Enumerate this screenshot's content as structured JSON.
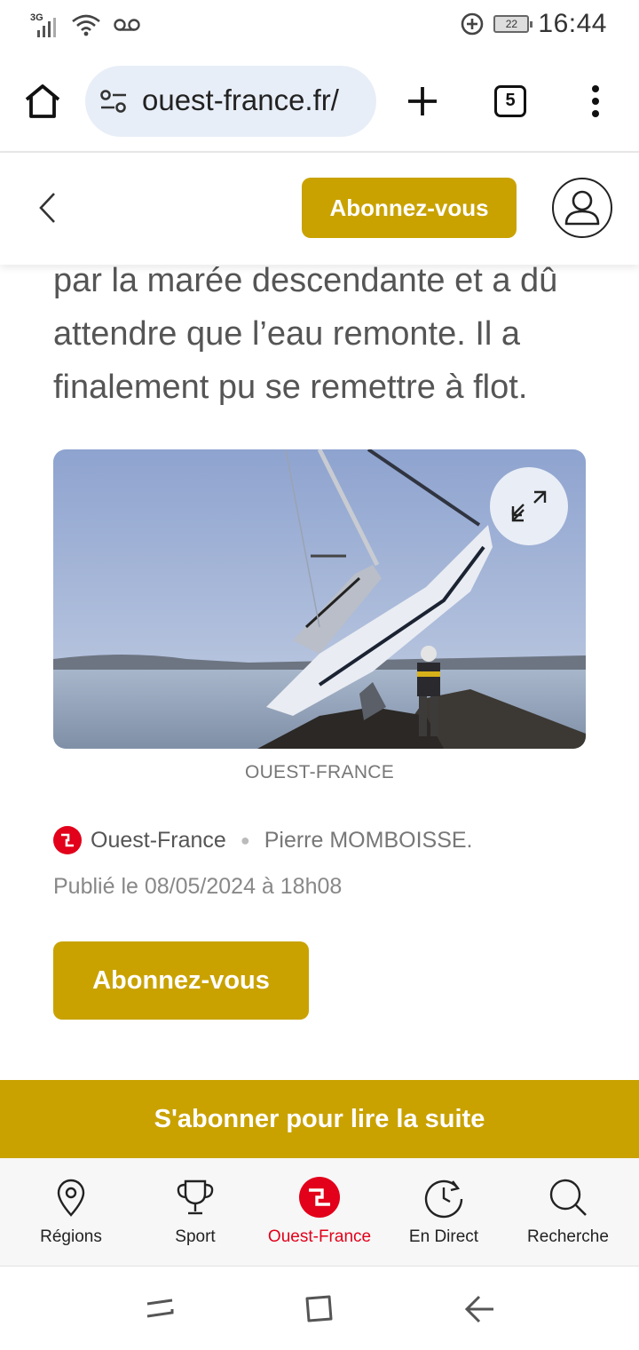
{
  "status_bar": {
    "network": "3G",
    "battery": "22",
    "time": "16:44"
  },
  "browser": {
    "url": "ouest-france.fr/",
    "tab_count": "5"
  },
  "site_header": {
    "subscribe_label": "Abonnez-vous"
  },
  "article": {
    "text": "par la marée descendante et a dû attendre que l’eau remonte. Il a finalement pu se remettre à flot.",
    "image_caption": "OUEST-FRANCE",
    "source": "Ouest-France",
    "author": "Pierre MOMBOISSE.",
    "published": "Publié le 08/05/2024 à 18h08",
    "subscribe_label": "Abonnez-vous"
  },
  "cta": {
    "label": "S'abonner pour lire la suite"
  },
  "bottom_nav": {
    "items": [
      {
        "label": "Régions",
        "icon": "map-pin-icon"
      },
      {
        "label": "Sport",
        "icon": "trophy-icon"
      },
      {
        "label": "Ouest-France",
        "icon": "ouest-france-logo-icon",
        "active": true
      },
      {
        "label": "En Direct",
        "icon": "clock-refresh-icon"
      },
      {
        "label": "Recherche",
        "icon": "search-icon"
      }
    ]
  },
  "colors": {
    "accent_gold": "#c9a200",
    "brand_red": "#e2001a"
  }
}
